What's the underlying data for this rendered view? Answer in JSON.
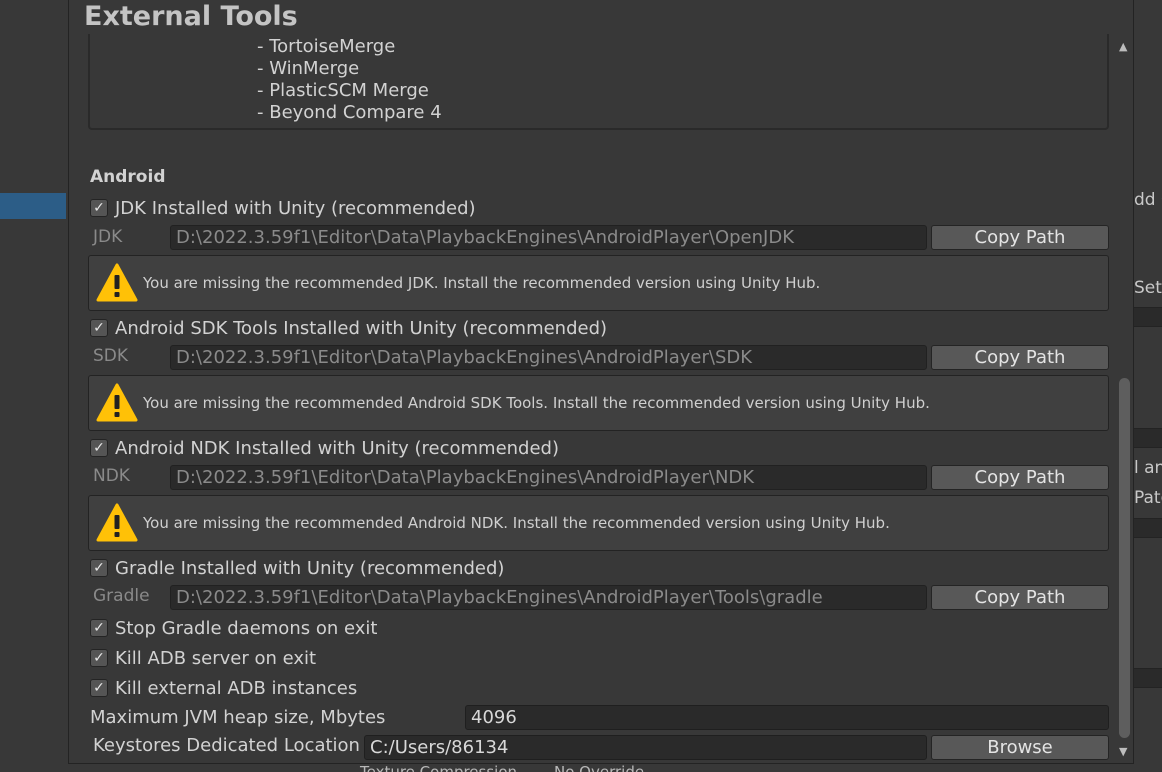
{
  "window": {
    "title": "External Tools"
  },
  "merge_tools": [
    "- TortoiseMerge",
    "- WinMerge",
    "- PlasticSCM Merge",
    "- Beyond Compare 4"
  ],
  "android": {
    "section_title": "Android",
    "jdk": {
      "toggle_label": "JDK Installed with Unity (recommended)",
      "checked": true,
      "field_label": "JDK",
      "path": "D:\\2022.3.59f1\\Editor\\Data\\PlaybackEngines\\AndroidPlayer\\OpenJDK",
      "button": "Copy Path",
      "warning": "You are missing the recommended JDK. Install the recommended version using Unity Hub."
    },
    "sdk": {
      "toggle_label": "Android SDK Tools Installed with Unity (recommended)",
      "checked": true,
      "field_label": "SDK",
      "path": "D:\\2022.3.59f1\\Editor\\Data\\PlaybackEngines\\AndroidPlayer\\SDK",
      "button": "Copy Path",
      "warning": "You are missing the recommended Android SDK Tools. Install the recommended version using Unity Hub."
    },
    "ndk": {
      "toggle_label": "Android NDK Installed with Unity (recommended)",
      "checked": true,
      "field_label": "NDK",
      "path": "D:\\2022.3.59f1\\Editor\\Data\\PlaybackEngines\\AndroidPlayer\\NDK",
      "button": "Copy Path",
      "warning": "You are missing the recommended Android NDK. Install the recommended version using Unity Hub."
    },
    "gradle": {
      "toggle_label": "Gradle Installed with Unity (recommended)",
      "checked": true,
      "field_label": "Gradle",
      "path": "D:\\2022.3.59f1\\Editor\\Data\\PlaybackEngines\\AndroidPlayer\\Tools\\gradle",
      "button": "Copy Path"
    },
    "options": [
      {
        "label": "Stop Gradle daemons on exit",
        "checked": true
      },
      {
        "label": "Kill ADB server on exit",
        "checked": true
      },
      {
        "label": "Kill external ADB instances",
        "checked": true
      }
    ],
    "max_jvm_heap": {
      "label": "Maximum JVM heap size, Mbytes",
      "value": "4096"
    },
    "keystores": {
      "label": "Keystores Dedicated Location",
      "value": "C:/Users/86134",
      "button": "Browse"
    }
  },
  "background": {
    "fragments": [
      "dd G",
      "Sett",
      "l an",
      "Pate"
    ],
    "bottom_texts": [
      "Texture Compression",
      "No Override"
    ]
  },
  "icons": {
    "checkmark": "checkmark-icon",
    "warning": "warning-icon",
    "scroll_up": "arrow-up-icon",
    "scroll_down": "arrow-down-icon"
  },
  "colors": {
    "window_bg": "#383838",
    "field_bg": "#2a2a2a",
    "button_bg": "#585858",
    "selection": "#2c5d87",
    "warning_yellow": "#ffc107"
  }
}
